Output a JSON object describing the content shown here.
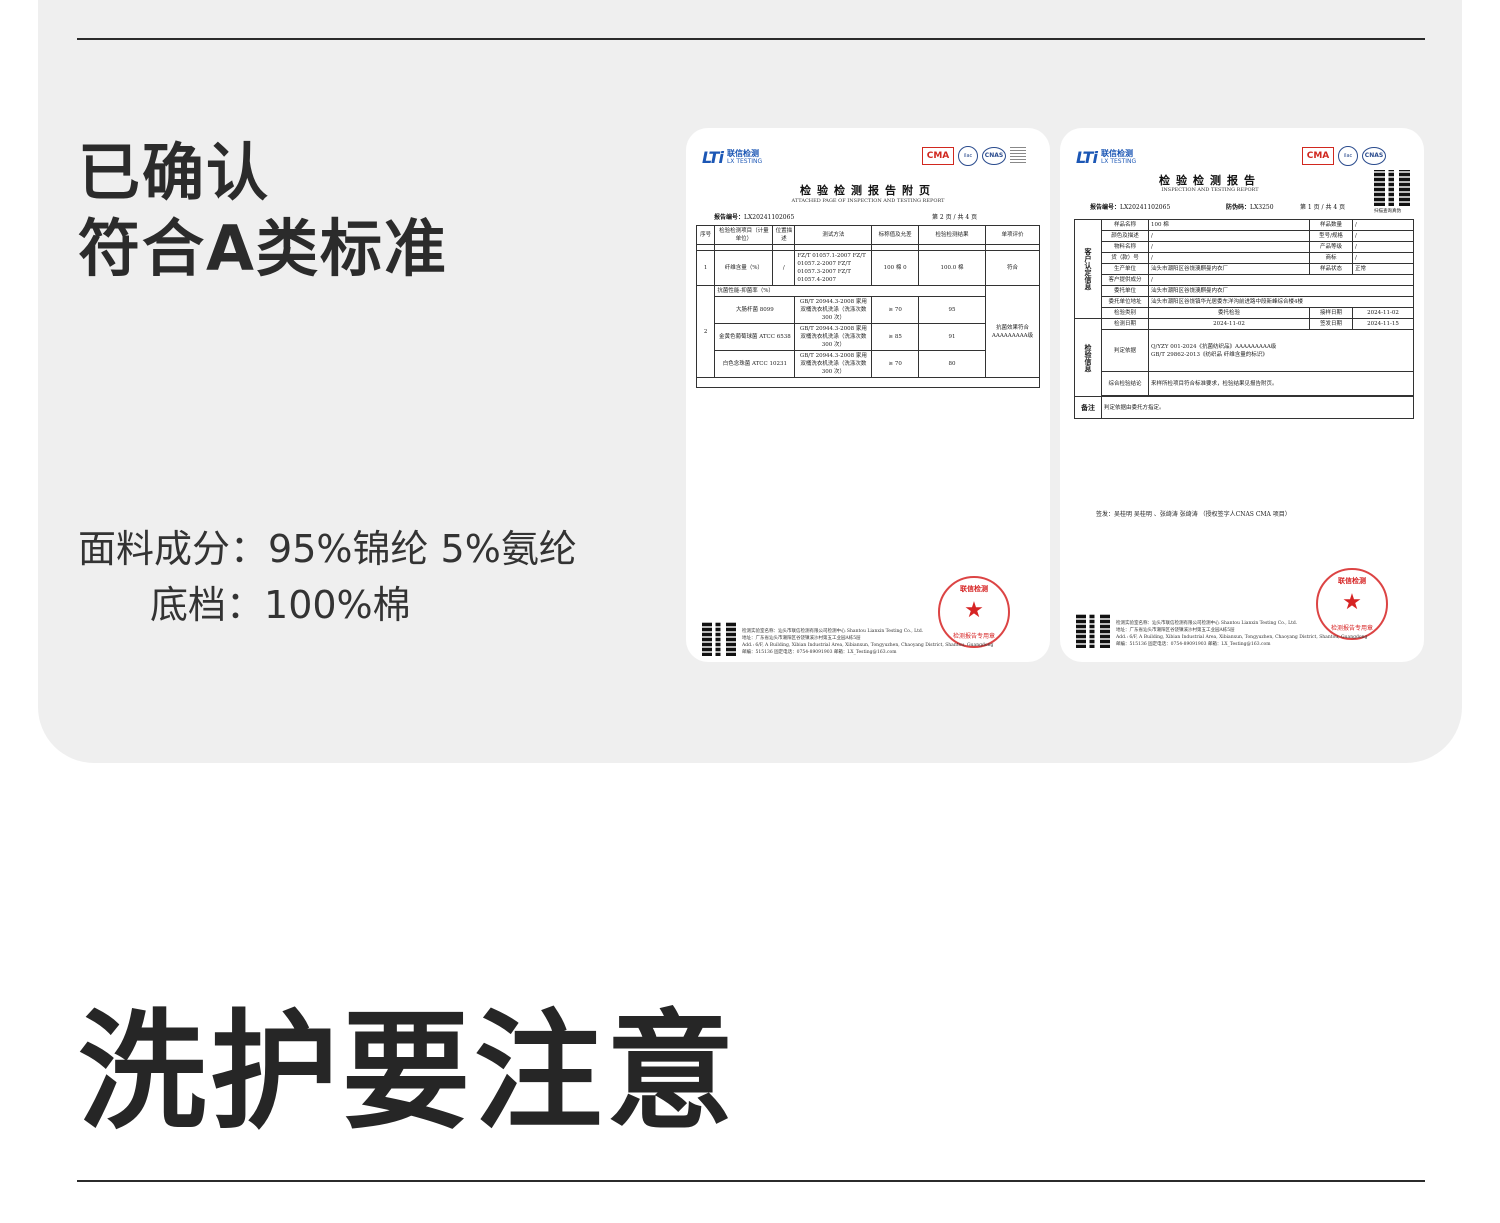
{
  "headline": {
    "line1": "已确认",
    "line2": "符合A类标准"
  },
  "specs": [
    {
      "label": "面料成分：",
      "value": "95%锦纶 5%氨纶"
    },
    {
      "label": "底档：",
      "value": "100%棉"
    }
  ],
  "section_title": "洗护要注意",
  "report_common": {
    "brand_cn": "联信检测",
    "brand_en": "LX TESTING",
    "cma": "CMA",
    "cnas": "CNAS",
    "report_no_label": "报告编号：",
    "report_no": "LX20241102065",
    "stamp_center": "★",
    "stamp_text": "检测报告专用章",
    "footer_lab": "检测实验室名称：汕头市联信检测有限公司检测中心  Shantou Lianxin Testing Co., Ltd.",
    "footer_addr": "地址：广东省汕头市潮阳区谷饶镇溪沙村第五工业园A栋5层",
    "footer_addr_en": "Add.: 6/F, A Building, Xibian Industrial Area, Xibianxun, Tongyuzhen, Chaoyang District, Shantou, Guangdong",
    "footer_contact": "邮编：515136   固定电话：0754-89091903   邮箱：LX_Testing@163.com"
  },
  "report_left": {
    "title": "检验检测报告附页",
    "subtitle": "ATTACHED PAGE OF INSPECTION AND TESTING REPORT",
    "page": "第 2 页 / 共 4 页",
    "headers": [
      "序号",
      "检验检测项目（计量单位）",
      "位置描述",
      "测试方法",
      "标称值及允差",
      "检验检测结果",
      "单项评价"
    ],
    "row1": {
      "no": "1",
      "item": "纤维含量（%）",
      "pos": "/",
      "method": "FZ/T 01057.1-2007 FZ/T 01057.2-2007 FZ/T 01057.3-2007 FZ/T 01057.4-2007",
      "nominal": "100 棉 0",
      "result": "100.0 棉",
      "eval": "符合"
    },
    "row2_group": "抗菌性能-抑菌率（%）",
    "row2_no": "2",
    "row2_eval": "抗菌效果符合AAAAAAAAA级",
    "row2_items": [
      {
        "item": "大肠杆菌 8099",
        "method": "GB/T 20944.3-2008 家用双桶洗衣机洗涤（洗涤次数 300 次）",
        "nominal": "≥ 70",
        "result": "95"
      },
      {
        "item": "金黄色葡萄球菌 ATCC 6538",
        "method": "GB/T 20944.3-2008 家用双桶洗衣机洗涤（洗涤次数 300 次）",
        "nominal": "≥ 85",
        "result": "91"
      },
      {
        "item": "白色念珠菌 ATCC 10231",
        "method": "GB/T 20944.3-2008 家用双桶洗衣机洗涤（洗涤次数 300 次）",
        "nominal": "≥ 70",
        "result": "80"
      }
    ]
  },
  "report_right": {
    "title": "检验检测报告",
    "subtitle": "INSPECTION AND TESTING REPORT",
    "anti_fake_label": "防伪码：",
    "anti_fake": "LX3250",
    "page": "第 1 页 / 共 4 页",
    "qr_caption": "扫描查询真伪",
    "client_group": "客户认定信息",
    "sample_name_label": "样品名称",
    "sample_name": "100 棉",
    "sample_qty_label": "样品数量",
    "sample_qty": "/",
    "color_label": "颜色及描述",
    "color": "/",
    "model_label": "型号/规格",
    "model": "/",
    "material_label": "物料名称",
    "material": "/",
    "grade_label": "产品等级",
    "grade": "/",
    "style_label": "货（款）号",
    "style": "/",
    "brand_label": "商标",
    "brand": "/",
    "producer_label": "生产单位",
    "producer": "汕头市潮阳区谷饶澳麒曼内衣厂",
    "state_label": "样品状态",
    "state": "正常",
    "client_comp_label": "客户提供成分",
    "client_comp": "/",
    "entrust_group": "委托方信息",
    "entrust_unit_label": "委托单位",
    "entrust_unit": "汕头市潮阳区谷饶澳麒曼内衣厂",
    "entrust_addr_label": "委托单位地址",
    "entrust_addr": "汕头市潮阳区谷饶镇华光居委东洋沟前进路中段新峰综合楼4楼",
    "inspect_group": "检验信息",
    "type_label": "检验类别",
    "type": "委托检验",
    "recv_label": "接样日期",
    "recv": "2024-11-02",
    "date_label": "检测日期",
    "date": "2024-11-02",
    "issue_label": "签发日期",
    "issue": "2024-11-15",
    "basis_label": "判定依据",
    "basis1": "Q/YZY 001-2024《抗菌纺织品》AAAAAAAAA级",
    "basis2": "GB/T 29862-2013《纺织品 纤维含量的标识》",
    "conclusion_label": "综合检验结论",
    "conclusion": "来样所检项目符合标准要求，检验结果见报告附页。",
    "remark_label": "备注",
    "remark": "判定依据由委托方指定。",
    "sign_line": "签发：吴桂明 吴桂明 、张绮涛 张绮涛 （授权签字人CNAS CMA 项目）"
  }
}
